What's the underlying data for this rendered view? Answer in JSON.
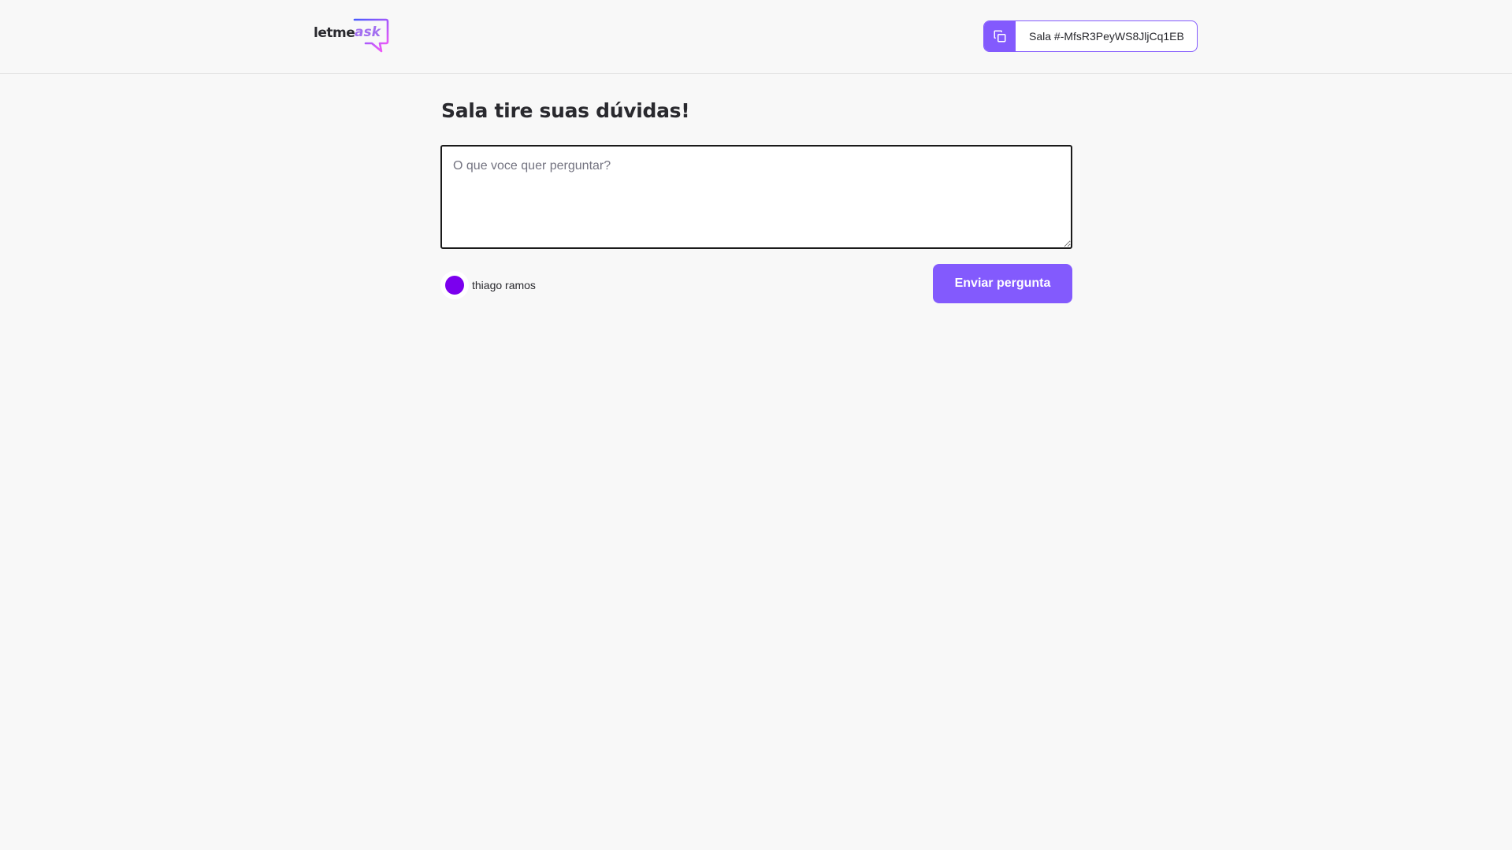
{
  "header": {
    "logo_text_1": "letme",
    "logo_text_2": "ask",
    "room_code_label": "Sala #-MfsR3PeyWS8JljCq1EB"
  },
  "main": {
    "title": "Sala tire suas dúvidas!",
    "question_placeholder": "O que voce quer perguntar?",
    "user_name": "thiago ramos",
    "send_button_label": "Enviar pergunta"
  },
  "colors": {
    "accent": "#835afd",
    "avatar": "#7b00ee",
    "background": "#f8f8f8"
  },
  "icons": {
    "copy": "copy-icon",
    "avatar": "avatar"
  }
}
